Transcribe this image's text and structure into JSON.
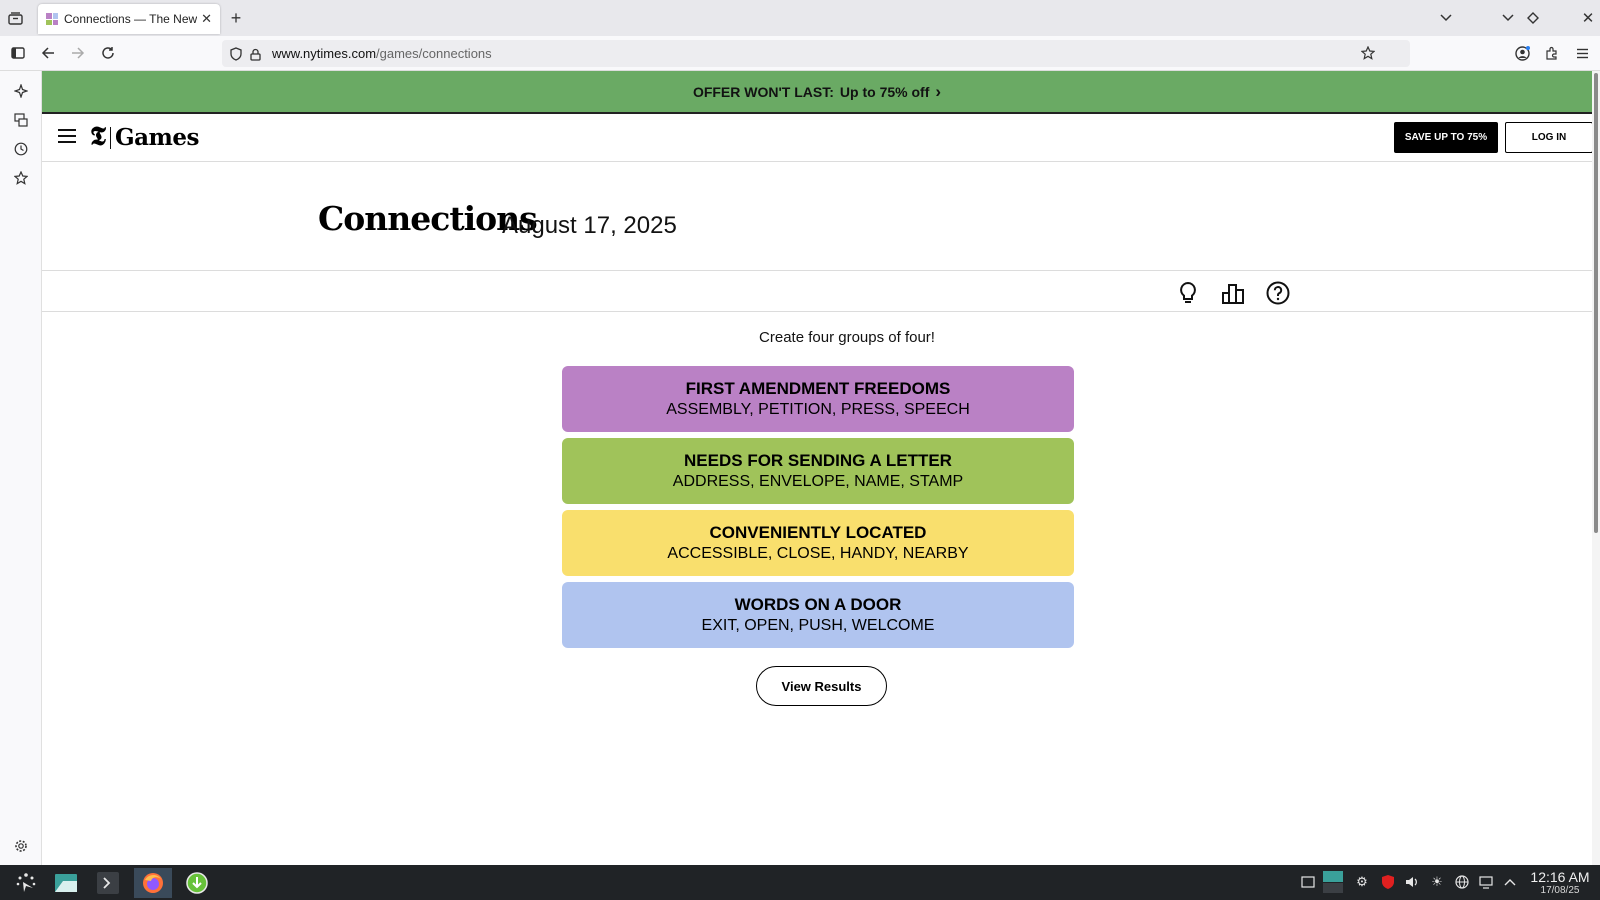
{
  "browser": {
    "tab_title": "Connections — The New Yo",
    "url_domain": "www.nytimes.com",
    "url_path": "/games/connections"
  },
  "banner": {
    "lead": "OFFER WON'T LAST:",
    "offer": "Up to 75% off",
    "chevron": "›"
  },
  "header": {
    "logo_mark": "𝕿",
    "brand": "Games",
    "save_button": "SAVE UP TO 75%",
    "login_button": "LOG IN"
  },
  "game": {
    "title": "Connections",
    "date": "August 17, 2025",
    "prompt": "Create four groups of four!",
    "view_results": "View Results",
    "groups": [
      {
        "name": "FIRST AMENDMENT FREEDOMS",
        "words": "ASSEMBLY, PETITION, PRESS, SPEECH",
        "color": "#ba81c5"
      },
      {
        "name": "NEEDS FOR SENDING A LETTER",
        "words": "ADDRESS, ENVELOPE, NAME, STAMP",
        "color": "#a0c35a"
      },
      {
        "name": "CONVENIENTLY LOCATED",
        "words": "ACCESSIBLE, CLOSE, HANDY, NEARBY",
        "color": "#f9df6d"
      },
      {
        "name": "WORDS ON A DOOR",
        "words": "EXIT, OPEN, PUSH, WELCOME",
        "color": "#b0c4ef"
      }
    ]
  },
  "taskbar": {
    "time": "12:16 AM",
    "date": "17/08/25"
  },
  "colors": {
    "banner_green": "#6aaa64",
    "purple": "#ba81c5",
    "green": "#a0c35a",
    "yellow": "#f9df6d",
    "blue": "#b0c4ef"
  }
}
